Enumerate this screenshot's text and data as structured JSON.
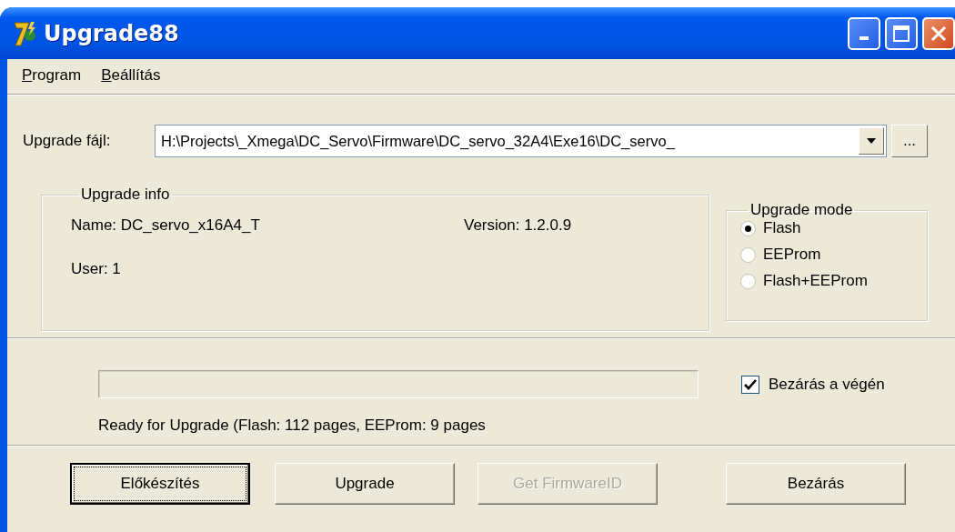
{
  "window": {
    "title": "Upgrade88"
  },
  "menu": [
    {
      "label": "Program"
    },
    {
      "label": "Beállítás"
    }
  ],
  "file": {
    "label": "Upgrade fájl:",
    "value": "H:\\Projects\\_Xmega\\DC_Servo\\Firmware\\DC_servo_32A4\\Exe16\\DC_servo_",
    "browse_button": "..."
  },
  "upgrade_info": {
    "title": "Upgrade info",
    "name": "Name: DC_servo_x16A4_T",
    "version": "Version: 1.2.0.9",
    "user": "User: 1"
  },
  "upgrade_mode": {
    "title": "Upgrade mode",
    "options": [
      {
        "label": "Flash",
        "selected": true
      },
      {
        "label": "EEProm",
        "selected": false
      },
      {
        "label": "Flash+EEProm",
        "selected": false
      }
    ]
  },
  "progress": {
    "level": 0
  },
  "close_at_end": {
    "label": "Bezárás a végén",
    "checked": true
  },
  "status": "Ready for Upgrade (Flash: 112 pages, EEProm: 9 pages",
  "buttons": [
    {
      "label": "Előkészítés",
      "default": true,
      "disabled": false
    },
    {
      "label": "Upgrade",
      "default": false,
      "disabled": false
    },
    {
      "label": "Get FirmwareID",
      "default": false,
      "disabled": true
    },
    {
      "label": "Bezárás",
      "default": false,
      "disabled": false
    }
  ]
}
